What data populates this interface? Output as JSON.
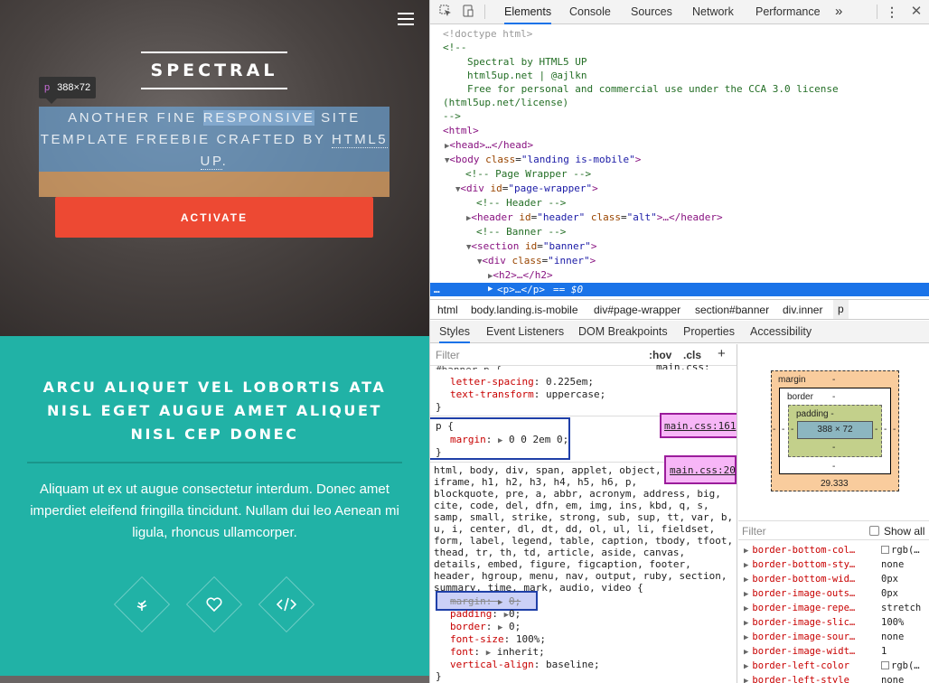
{
  "site": {
    "title": "SPECTRAL",
    "inspect_tag": "p",
    "inspect_size": "388×72",
    "tagline_pre": "ANOTHER FINE ",
    "tagline_sel": "RESPONSIVE",
    "tagline_mid": " SITE TEMPLATE FREEBIE CRAFTED BY ",
    "tagline_link": "HTML5 UP",
    "tagline_end": ".",
    "button": "ACTIVATE",
    "section_heading": "ARCU ALIQUET VEL LOBORTIS ATA NISL EGET AUGUE AMET ALIQUET NISL CEP DONEC",
    "section_text": "Aliquam ut ex ut augue consectetur interdum. Donec amet imperdiet eleifend fringilla tincidunt. Nullam dui leo Aenean mi ligula, rhoncus ullamcorper.",
    "icons": [
      "leaf-icon",
      "heart-icon",
      "code-icon"
    ],
    "colors": {
      "button": "#ed4933",
      "section": "#21b2a6"
    }
  },
  "devtools": {
    "tabs": [
      "Elements",
      "Console",
      "Sources",
      "Network",
      "Performance"
    ],
    "more": "»",
    "elements": {
      "doctype": "<!doctype html>",
      "comment_open": "<!--",
      "comment_l1": "Spectral by HTML5 UP",
      "comment_l2": "html5up.net | @ajlkn",
      "comment_l3": "Free for personal and commercial use under the CCA 3.0 license",
      "comment_l4": "(html5up.net/license)",
      "comment_close": "-->",
      "html_open": "<html>",
      "head": "<head>…</head>",
      "body_tag": "body",
      "body_class_attr": "class",
      "body_class_val": "\"landing is-mobile\"",
      "c_page_wrapper": "<!-- Page Wrapper -->",
      "div_tag": "div",
      "div_id_attr": "id",
      "div_id_val": "\"page-wrapper\"",
      "c_header": "<!-- Header -->",
      "header_tag": "header",
      "header_id_val": "\"header\"",
      "header_class_val": "\"alt\"",
      "header_close": ">…</header>",
      "c_banner": "<!-- Banner -->",
      "section_tag": "section",
      "section_id_val": "\"banner\"",
      "inner_tag": "div",
      "inner_class_val": "\"inner\"",
      "h2": "<h2>…</h2>",
      "selected_p": "<p>…</p>",
      "selected_eq": "== $0",
      "dots": "…"
    },
    "breadcrumbs": [
      "html",
      "body.landing.is-mobile",
      "div#page-wrapper",
      "section#banner",
      "div.inner",
      "p"
    ],
    "pane_tabs": [
      "Styles",
      "Event Listeners",
      "DOM Breakpoints",
      "Properties",
      "Accessibility"
    ],
    "styles": {
      "filter_placeholder": "Filter",
      "hov": ":hov",
      "cls": ".cls",
      "rule0_cut": "#banner p {",
      "rule0_link": "main.css:____",
      "rule0_props": [
        {
          "name": "letter-spacing",
          "value": "0.225em;"
        },
        {
          "name": "text-transform",
          "value": "uppercase;"
        }
      ],
      "rule1_selector": "p {",
      "rule1_prop": "margin",
      "rule1_value": "0 0 2em 0;",
      "rule1_link": "main.css:161",
      "rule2_link": "main.css:20",
      "rule2_selector_lines": [
        "html, body, div, span, applet, object,",
        "iframe, h1, h2, h3, h4, h5, h6, p,",
        "blockquote, pre, a, abbr, acronym, address, big,",
        "cite, code, del, dfn, em, img, ins, kbd, q, s,",
        "samp, small, strike, strong, sub, sup, tt, var, b,",
        "u, i, center, dl, dt, dd, ol, ul, li, fieldset,",
        "form, label, legend, table, caption, tbody, tfoot,",
        "thead, tr, th, td, article, aside, canvas,",
        "details, embed, figure, figcaption, footer,",
        "header, hgroup, menu, nav, output, ruby, section,",
        "summary, time, mark, audio, video {"
      ],
      "rule2_props": [
        {
          "name": "margin",
          "value": "0;",
          "struck": true
        },
        {
          "name": "padding",
          "value": "0;"
        },
        {
          "name": "border",
          "value": "0;"
        },
        {
          "name": "font-size",
          "value": "100%;"
        },
        {
          "name": "font",
          "value": "inherit;"
        },
        {
          "name": "vertical-align",
          "value": "baseline;"
        }
      ],
      "close": "}"
    },
    "box_model": {
      "margin_label": "margin",
      "border_label": "border",
      "padding_label": "padding -",
      "content": "388 × 72",
      "dash": "-",
      "margin_bottom": "29.333"
    },
    "computed": {
      "filter_placeholder": "Filter",
      "show_all": "Show all",
      "props": [
        {
          "name": "border-bottom-col…",
          "value": "rgb(…"
        },
        {
          "name": "border-bottom-sty…",
          "value": "none"
        },
        {
          "name": "border-bottom-wid…",
          "value": "0px"
        },
        {
          "name": "border-image-outs…",
          "value": "0px"
        },
        {
          "name": "border-image-repe…",
          "value": "stretch"
        },
        {
          "name": "border-image-slic…",
          "value": "100%"
        },
        {
          "name": "border-image-sour…",
          "value": "none"
        },
        {
          "name": "border-image-widt…",
          "value": "1"
        },
        {
          "name": "border-left-color",
          "value": "rgb(…"
        },
        {
          "name": "border-left-style",
          "value": "none"
        }
      ]
    }
  }
}
